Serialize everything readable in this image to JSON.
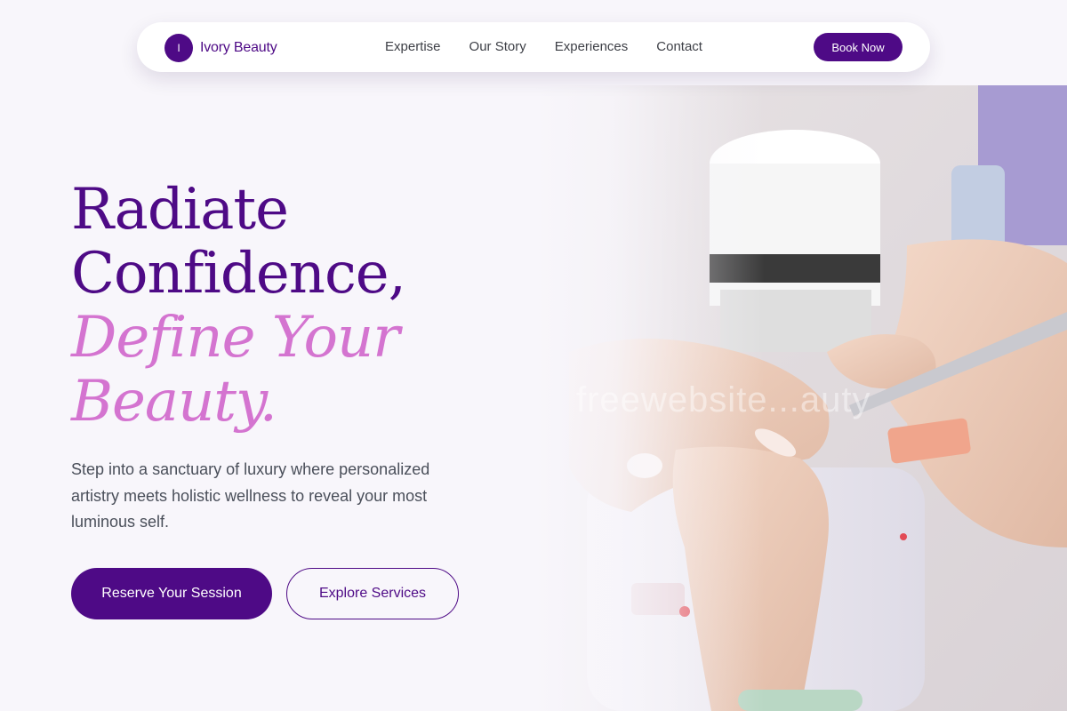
{
  "brand": {
    "logo_initial": "I",
    "name": "Ivory Beauty"
  },
  "nav": {
    "links": [
      "Expertise",
      "Our Story",
      "Experiences",
      "Contact"
    ],
    "cta_label": "Book Now"
  },
  "hero": {
    "headline_line1": "Radiate",
    "headline_line2": "Confidence,",
    "headline_accent_line1": "Define Your",
    "headline_accent_line2": "Beauty.",
    "subtext": "Step into a sanctuary of luxury where personalized artistry meets holistic wellness to reveal your most luminous self.",
    "primary_cta": "Reserve Your Session",
    "secondary_cta": "Explore Services",
    "image_watermark": "freewebsite...auty"
  },
  "colors": {
    "primary": "#4e0a86",
    "accent": "#d474d0",
    "background": "#f8f6fb",
    "body_text": "#4a4f5a"
  }
}
